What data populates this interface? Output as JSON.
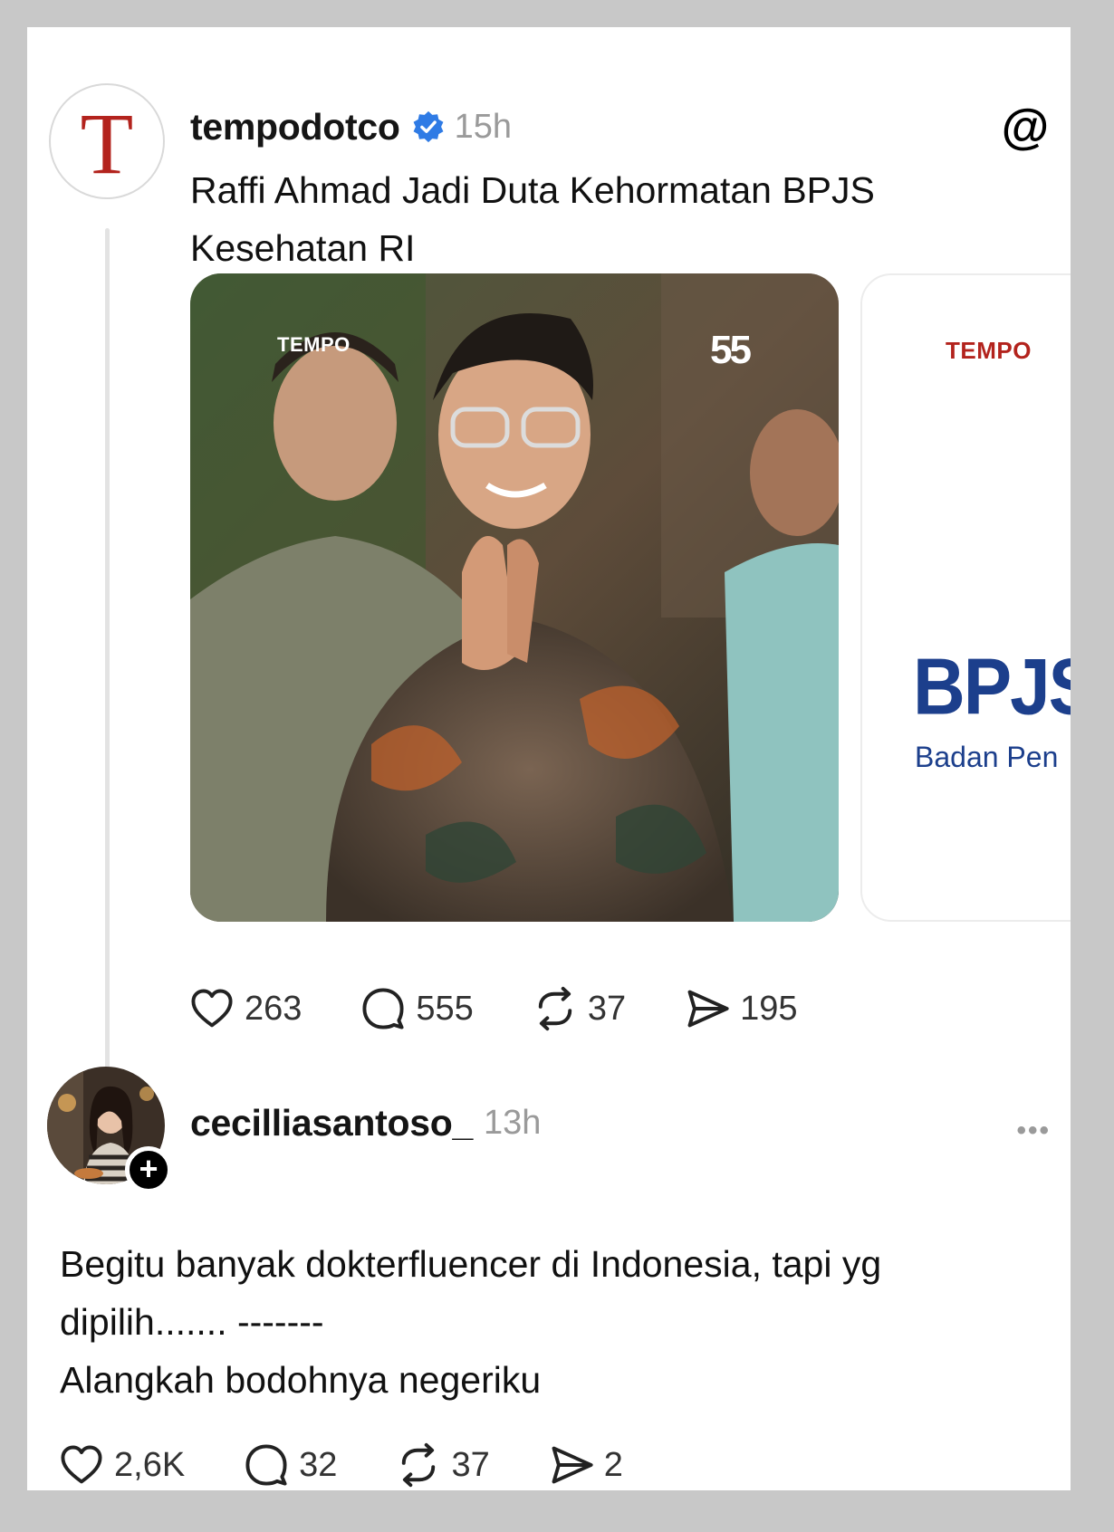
{
  "post1": {
    "avatar_letter": "T",
    "username": "tempodotco",
    "time": "15h",
    "text": "Raffi Ahmad Jadi Duta Kehormatan BPJS Kesehatan RI",
    "media1": {
      "watermark_left": "TEMPO",
      "watermark_right": "55"
    },
    "media2": {
      "tempo": "TEMPO",
      "bpjs": "BPJS",
      "subtitle": "Badan Pen"
    },
    "actions": {
      "likes": "263",
      "replies": "555",
      "reposts": "37",
      "shares": "195"
    }
  },
  "post2": {
    "username": "cecilliasantoso_",
    "time": "13h",
    "follow_symbol": "+",
    "more_symbol": "•••",
    "lines": [
      "Begitu banyak dokterfluencer di Indonesia, tapi yg dipilih....... -------",
      "Alangkah bodohnya negeriku"
    ],
    "actions": {
      "likes": "2,6K",
      "replies": "32",
      "reposts": "37",
      "shares": "2"
    }
  },
  "icons": {
    "verified": "verified-badge-icon",
    "threads": "threads-logo-icon",
    "like": "heart-icon",
    "reply": "comment-bubble-icon",
    "repost": "repost-icon",
    "share": "send-icon"
  },
  "colors": {
    "verified": "#2f7be5",
    "tempo_red": "#b3231d",
    "bpjs_blue": "#1c3f8c",
    "muted": "#9a9a9a"
  }
}
